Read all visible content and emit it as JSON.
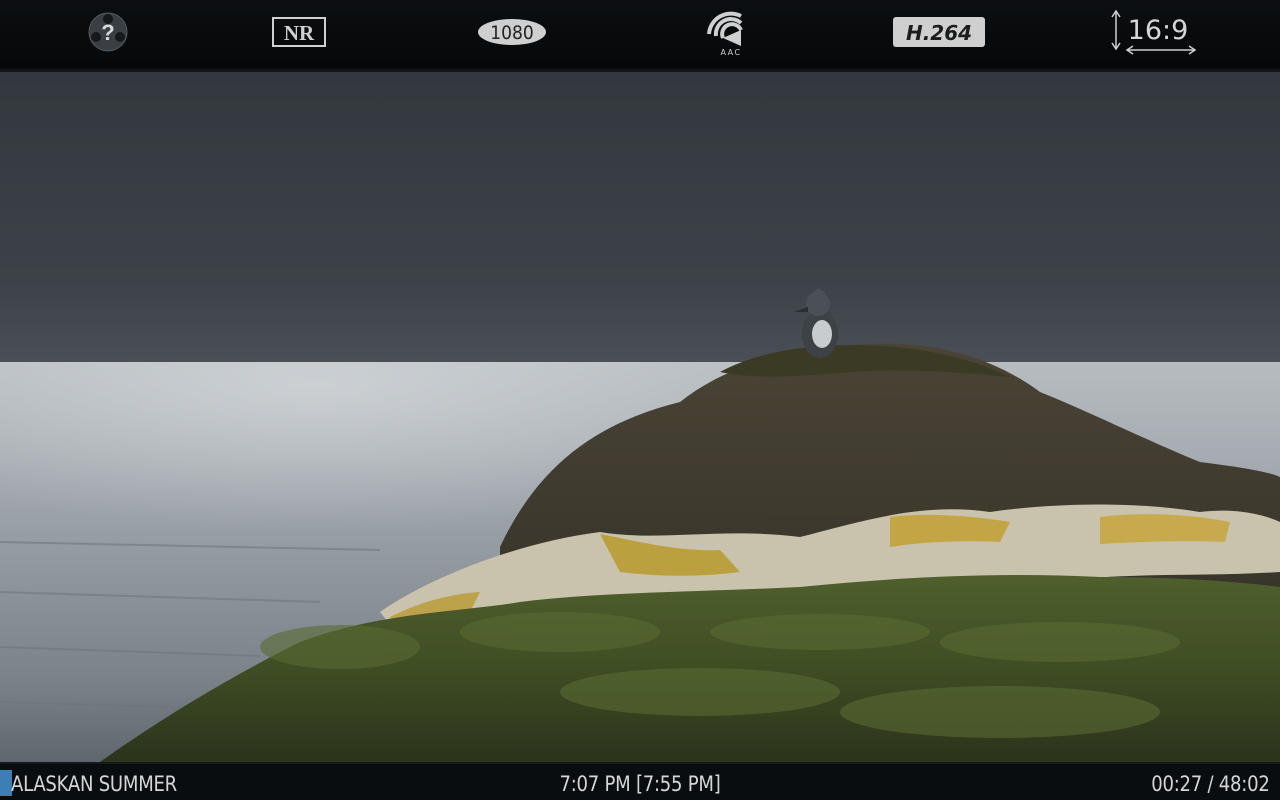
{
  "top_flags": {
    "unknown_icon": "question-mark-reel",
    "nr_label": "NR",
    "resolution_label": "1080",
    "audio_codec_label": "AAC",
    "video_codec_label": "H.264",
    "aspect_label": "16:9"
  },
  "bottom_bar": {
    "title": "ALASKAN SUMMER",
    "clock": "7:07 PM [7:55 PM]",
    "elapsed_total": "00:27 / 48:02",
    "progress_fraction": 0.0094
  },
  "colors": {
    "progress_accent": "#3b7fb6",
    "bar_background": "#0a0d10"
  }
}
